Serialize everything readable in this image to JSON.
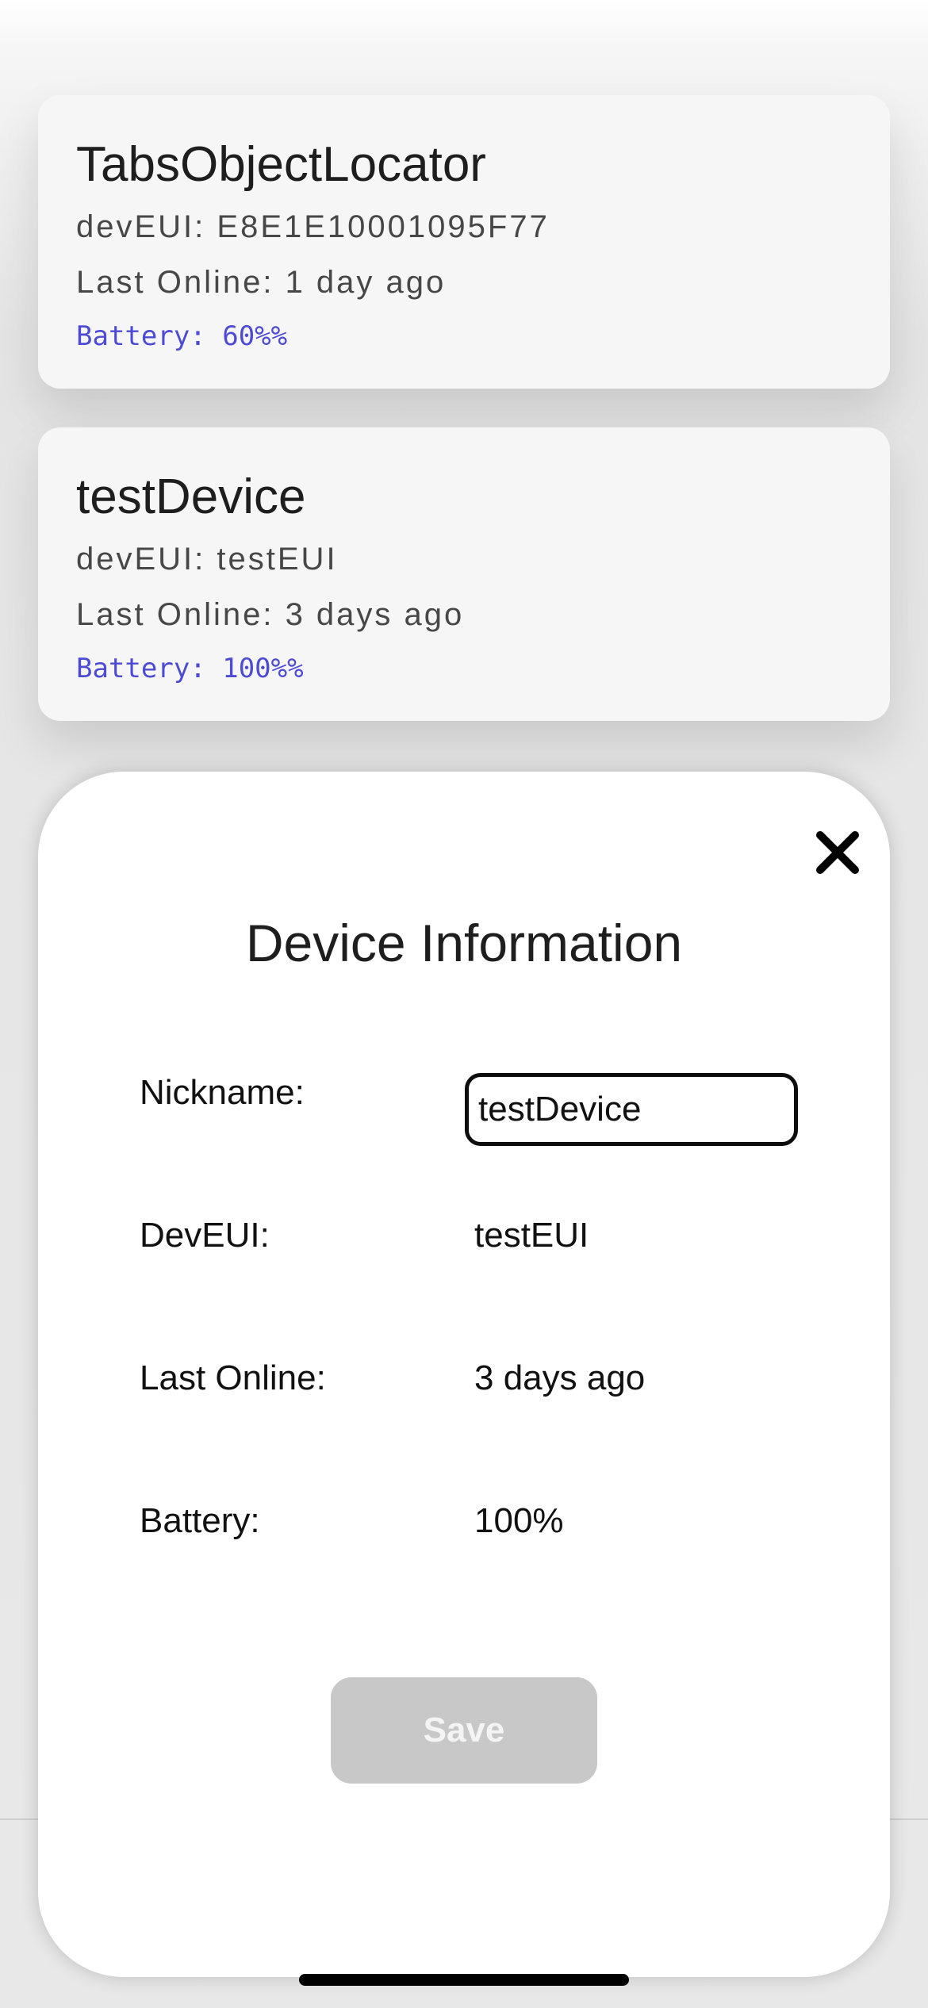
{
  "devices": [
    {
      "name": "TabsObjectLocator",
      "deveui_text": "devEUI: E8E1E10001095F77",
      "last_online_text": "Last Online: 1 day ago",
      "battery_text": "Battery: 60%%"
    },
    {
      "name": "testDevice",
      "deveui_text": "devEUI: testEUI",
      "last_online_text": "Last Online: 3 days ago",
      "battery_text": "Battery: 100%%"
    }
  ],
  "modal": {
    "title": "Device Information",
    "close_icon": "close-x-icon",
    "nickname_label": "Nickname:",
    "nickname_value": "testDevice",
    "deveui_label": "DevEUI:",
    "deveui_value": "testEUI",
    "last_online_label": "Last Online:",
    "last_online_value": "3 days ago",
    "battery_label": "Battery:",
    "battery_value": "100%",
    "save_label": "Save"
  },
  "colors": {
    "battery_accent": "#4d4bd4",
    "save_disabled_bg": "#c8c8c8",
    "input_border": "#0d0d0d"
  }
}
